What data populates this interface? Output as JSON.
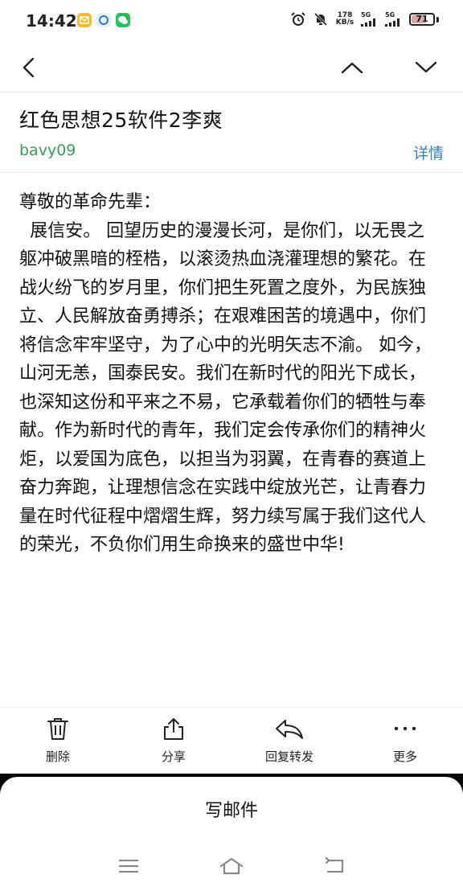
{
  "status_bar": {
    "time": "14:42",
    "net_speed_value": "178",
    "net_speed_unit": "KB/s",
    "signal_1": "5G",
    "signal_2": "5G",
    "battery": "71",
    "battery_level": 0.71
  },
  "nav": {
    "back_icon": "chevron-left-icon",
    "prev_icon": "chevron-up-icon",
    "next_icon": "chevron-down-icon"
  },
  "mail": {
    "subject": "红色思想25软件2李爽",
    "sender": "bavy09",
    "details_label": "详情",
    "greeting": "尊敬的革命先辈：",
    "content": "展信安。 回望历史的漫漫长河，是你们，以无畏之躯冲破黑暗的桎梏，以滚烫热血浇灌理想的繁花。在战火纷飞的岁月里，你们把生死置之度外，为民族独立、人民解放奋勇搏杀；在艰难困苦的境遇中，你们将信念牢牢坚守，为了心中的光明矢志不渝。 如今，山河无恙，国泰民安。我们在新时代的阳光下成长，也深知这份和平来之不易，它承载着你们的牺牲与奉献。作为新时代的青年，我们定会传承你们的精神火炬，以爱国为底色，以担当为羽翼，在青春的赛道上奋力奔跑，让理想信念在实践中绽放光芒，让青春力量在时代征程中熠熠生辉，努力续写属于我们这代人的荣光，不负你们用生命换来的盛世中华!"
  },
  "actions": [
    {
      "label": "删除",
      "icon": "trash-icon"
    },
    {
      "label": "分享",
      "icon": "share-icon"
    },
    {
      "label": "回复转发",
      "icon": "reply-icon"
    },
    {
      "label": "更多",
      "icon": "more-icon"
    }
  ],
  "compose": {
    "label": "写邮件"
  },
  "colors": {
    "sender": "#3d9a5c",
    "link": "#3b82c4"
  }
}
